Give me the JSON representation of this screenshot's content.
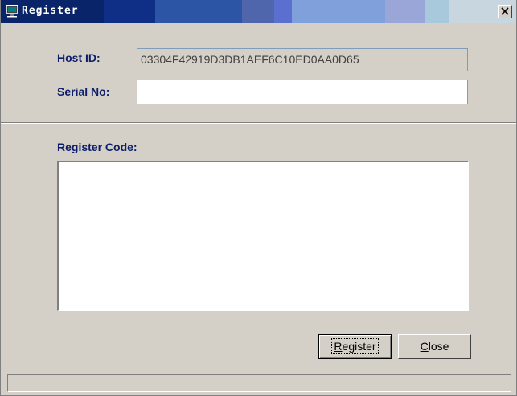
{
  "window": {
    "title": "Register",
    "icon": "computer-monitor-icon",
    "close_glyph": "✕"
  },
  "form": {
    "host_id_label": "Host ID:",
    "host_id_value": "03304F42919D3DB1AEF6C10ED0AA0D65",
    "serial_label": "Serial No:",
    "serial_value": "",
    "register_code_label": "Register Code:",
    "register_code_value": ""
  },
  "buttons": {
    "register_mnemonic": "R",
    "register_rest": "egister",
    "close_mnemonic": "C",
    "close_rest": "lose"
  },
  "colors": {
    "title_bar": "#0a246a",
    "label_text": "#0c1e6b",
    "window_bg": "#d4d0c8"
  }
}
